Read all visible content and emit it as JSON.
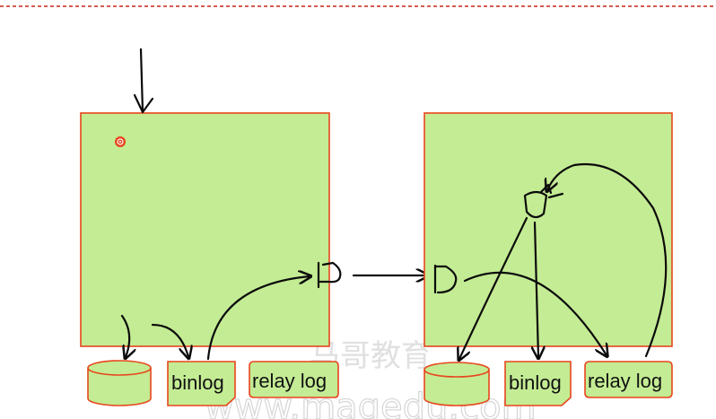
{
  "colors": {
    "box_fill": "#c4ec94",
    "box_stroke": "#e8451c",
    "ink": "#0b0b0b",
    "border_dashes": "#c8241b",
    "watermark": "#c8c8c8"
  },
  "master": {
    "labels": {
      "binlog": "binlog",
      "relay_log": "relay log"
    }
  },
  "slave": {
    "labels": {
      "binlog": "binlog",
      "relay_log": "relay log"
    }
  },
  "watermark": {
    "chinese": "马哥教育",
    "url": "www.magedu.com"
  }
}
